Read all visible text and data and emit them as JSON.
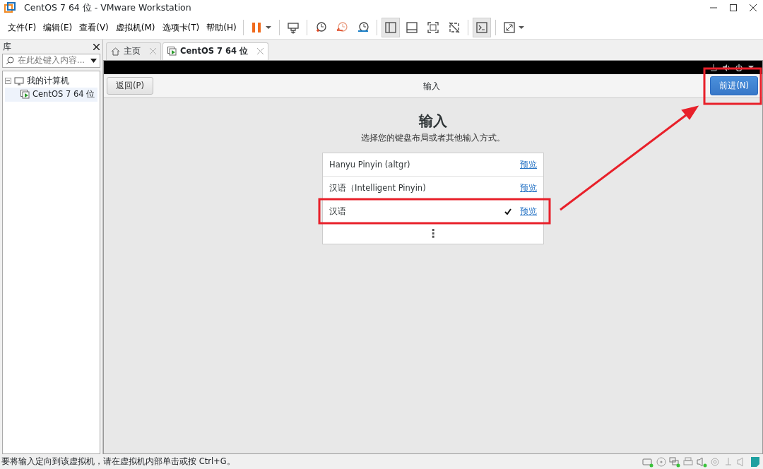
{
  "window": {
    "title": "CentOS 7 64 位 - VMware Workstation"
  },
  "menu": [
    "文件(F)",
    "编辑(E)",
    "查看(V)",
    "虚拟机(M)",
    "选项卡(T)",
    "帮助(H)"
  ],
  "toolbar": [
    {
      "kind": "pause",
      "pressed": false
    },
    {
      "kind": "send-keys",
      "pressed": false
    },
    {
      "kind": "snapshot",
      "pressed": false
    },
    {
      "kind": "revert",
      "pressed": false
    },
    {
      "kind": "snapshot-manager",
      "pressed": false
    },
    {
      "kind": "library-view",
      "pressed": true
    },
    {
      "kind": "thumbnail-view",
      "pressed": false
    },
    {
      "kind": "fullscreen",
      "pressed": false
    },
    {
      "kind": "unity",
      "pressed": false
    },
    {
      "kind": "console",
      "pressed": true
    },
    {
      "kind": "stretch",
      "pressed": false
    }
  ],
  "library": {
    "title": "库",
    "search": {
      "placeholder": "在此处键入内容..."
    },
    "tree": [
      {
        "label": "我的计算机",
        "expanded": true,
        "selected": false,
        "children": [
          {
            "label": "CentOS 7 64 位",
            "selected": true
          }
        ]
      }
    ]
  },
  "tabs": [
    {
      "label": "主页",
      "kind": "home",
      "selected": false
    },
    {
      "label": "CentOS 7 64 位",
      "kind": "vm",
      "selected": true
    }
  ],
  "installer": {
    "back": "返回(P)",
    "title": "输入",
    "next": "前进(N)",
    "heading": "输入",
    "subtitle": "选择您的键盘布局或者其他输入方式。",
    "layouts": [
      {
        "name": "Hanyu Pinyin (altgr)",
        "checked": false,
        "preview": "预览"
      },
      {
        "name": "汉语（Intelligent Pinyin)",
        "checked": false,
        "preview": "预览"
      },
      {
        "name": "汉语",
        "checked": true,
        "preview": "预览"
      }
    ],
    "more": "⋮"
  },
  "status_bar": {
    "text": "要将输入定向到该虚拟机，请在虚拟机内部单击或按 Ctrl+G。"
  }
}
